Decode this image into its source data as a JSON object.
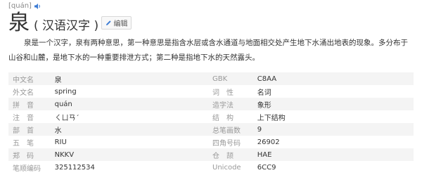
{
  "pinyin": "[quán]",
  "character": "泉",
  "char_type": "( 汉语汉字 )",
  "edit_label": "编辑",
  "description": "泉是一个汉字，泉有两种意思，第一种意思是指含水层或含水通道与地面相交处产生地下水涌出地表的现象。多分布于山谷和山麓，是地下水的一种重要排泄方式；第二种是指地下水的天然露头。",
  "table": [
    {
      "l1": "中文名",
      "v1": "泉",
      "l2": "GBK",
      "v2": "C8AA"
    },
    {
      "l1": "外文名",
      "v1": "spring",
      "l2": "词　性",
      "v2": "名词"
    },
    {
      "l1": "拼　音",
      "v1": "quán",
      "l2": "造字法",
      "v2": "象形"
    },
    {
      "l1": "注　音",
      "v1": "ㄑㄩㄢˊ",
      "l2": "结　构",
      "v2": "上下结构"
    },
    {
      "l1": "部　首",
      "v1": "水",
      "l2": "总笔画数",
      "v2": "9"
    },
    {
      "l1": "五　笔",
      "v1": "RIU",
      "l2": "四角号码",
      "v2": "26902"
    },
    {
      "l1": "郑　码",
      "v1": "NKKV",
      "l2": "仓　颉",
      "v2": "HAE"
    },
    {
      "l1": "笔顺编码",
      "v1": "325112534",
      "l2": "Unicode",
      "v2": "6CC9"
    }
  ]
}
